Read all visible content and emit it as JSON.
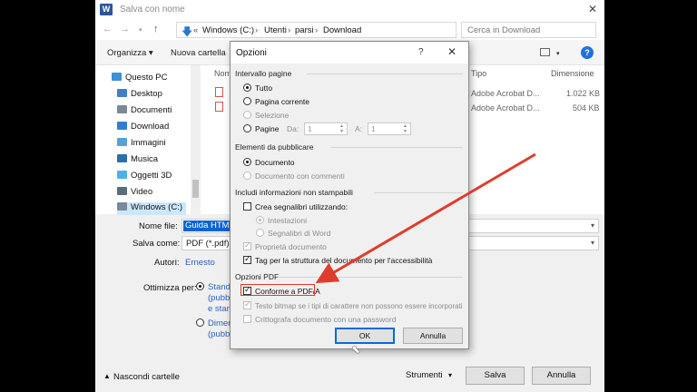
{
  "window": {
    "title": "Salva con nome",
    "app_icon_letter": "W",
    "close_glyph": "✕"
  },
  "address": {
    "crumbs": [
      "Windows (C:)",
      "Utenti",
      "parsi",
      "Download"
    ],
    "overflow": "«",
    "search_placeholder": "Cerca in Download"
  },
  "toolbar": {
    "organize": "Organizza ▾",
    "new_folder": "Nuova cartella",
    "help_glyph": "?"
  },
  "nav": [
    {
      "label": "Questo PC",
      "color": "#3d8fd8"
    },
    {
      "label": "Desktop",
      "color": "#3f80c9"
    },
    {
      "label": "Documenti",
      "color": "#7b8896"
    },
    {
      "label": "Download",
      "color": "#2c7fd8"
    },
    {
      "label": "Immagini",
      "color": "#5aa0d8"
    },
    {
      "label": "Musica",
      "color": "#2c6fb0"
    },
    {
      "label": "Oggetti 3D",
      "color": "#4cb3e6"
    },
    {
      "label": "Video",
      "color": "#5b6b7b"
    },
    {
      "label": "Windows (C:)",
      "color": "#7a8a9a"
    }
  ],
  "columns": {
    "name": "Nom",
    "type": "Tipo",
    "size": "Dimensione"
  },
  "files": [
    {
      "type": "Adobe Acrobat D...",
      "size": "1.022 KB"
    },
    {
      "type": "Adobe Acrobat D...",
      "size": "504 KB"
    }
  ],
  "form": {
    "name_label": "Nome file:",
    "name_value": "Guida HTML",
    "type_label": "Salva come:",
    "type_value": "PDF (*.pdf)",
    "authors_label": "Autori:",
    "authors_value": "Ernesto",
    "optimize_label": "Ottimizza per:",
    "opt1_lines": [
      "Standa",
      "(pubb",
      "e stam"
    ],
    "opt2_lines": [
      "Dimen",
      "(pubb"
    ]
  },
  "bottom": {
    "hide_folders": "Nascondi cartelle",
    "tools": "Strumenti",
    "save": "Salva",
    "cancel": "Annulla"
  },
  "options": {
    "title": "Opzioni",
    "help": "?",
    "close": "✕",
    "range_section": "Intervallo pagine",
    "range_all": "Tutto",
    "range_current": "Pagina corrente",
    "range_selection": "Selezione",
    "range_pages": "Pagine",
    "from_label": "Da:",
    "from_value": "1",
    "to_label": "A:",
    "to_value": "1",
    "publish_section": "Elementi da pubblicare",
    "publish_doc": "Documento",
    "publish_doc_comments": "Documento con commenti",
    "nonprint_section": "Includi informazioni non stampabili",
    "create_bookmarks": "Crea segnalibri utilizzando:",
    "headings": "Intestazioni",
    "word_bookmarks": "Segnalibri di Word",
    "doc_properties": "Proprietà documento",
    "tags": "Tag per la struttura del documento per l'accessibilità",
    "pdf_section": "Opzioni PDF",
    "pdfa": "Conforme a PDF/A",
    "bitmap_text": "Testo bitmap se i tipi di carattere non possono essere incorporati",
    "encrypt": "Crittografa documento con una password",
    "ok": "OK",
    "cancel": "Annulla"
  }
}
